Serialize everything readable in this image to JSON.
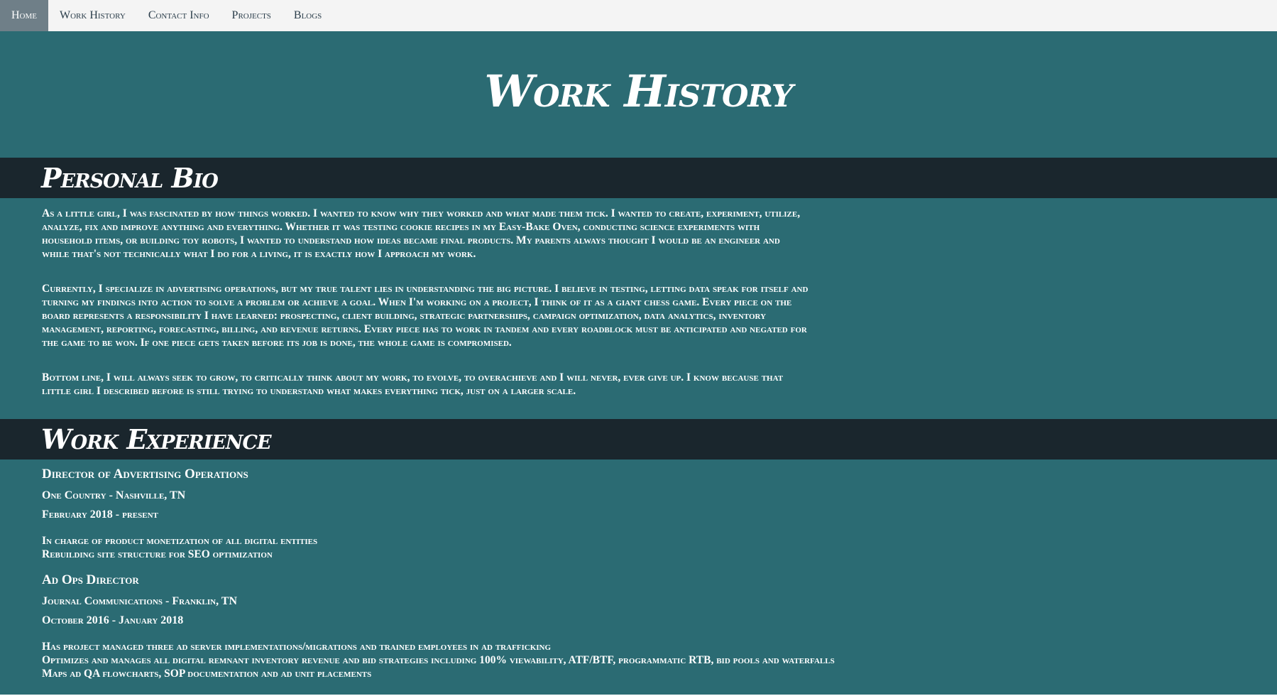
{
  "nav": {
    "items": [
      {
        "label": "Home",
        "active": true
      },
      {
        "label": "Work History",
        "active": false
      },
      {
        "label": "Contact Info",
        "active": false
      },
      {
        "label": "Projects",
        "active": false
      },
      {
        "label": "Blogs",
        "active": false
      }
    ]
  },
  "hero": {
    "title": "Work History"
  },
  "bio": {
    "heading": "Personal Bio",
    "paragraphs": [
      "As a little girl, I was fascinated by how things worked. I wanted to know why they worked and what made them tick. I wanted to create, experiment, utilize, analyze, fix and improve anything and everything. Whether it was testing cookie recipes in my Easy-Bake Oven, conducting science experiments with household items, or building toy robots, I wanted to understand how ideas became final products. My parents always thought I would be an engineer and while that's not technically what I do for a living, it is exactly how I approach my work.",
      "Currently, I specialize in advertising operations, but my true talent lies in understanding the big picture. I believe in testing, letting data speak for itself and turning my findings into action to solve a problem or achieve a goal. When I'm working on a project, I think of it as a giant chess game. Every piece on the board represents a responsibility I have learned: prospecting, client building, strategic partnerships, campaign optimization, data analytics, inventory management, reporting, forecasting, billing, and revenue returns. Every piece has to work in tandem and every roadblock must be anticipated and negated for the game to be won. If one piece gets taken before its job is done, the whole game is compromised.",
      "Bottom line, I will always seek to grow, to critically think about my work, to evolve, to overachieve and I will never, ever give up. I know because that little girl I described before is still trying to understand what makes everything tick, just on a larger scale."
    ]
  },
  "experience": {
    "heading": "Work Experience",
    "jobs": [
      {
        "title": "Director of Advertising Operations",
        "company": "One Country - Nashville, TN",
        "dates": "February 2018 - present",
        "duties": [
          "In charge of product monetization of all digital entities",
          "Rebuilding site structure for SEO optimization"
        ]
      },
      {
        "title": "Ad Ops Director",
        "company": "Journal Communications - Franklin, TN",
        "dates": "October 2016 - January 2018",
        "duties": [
          "Has project managed three ad server implementations/migrations and trained employees in ad trafficking",
          "Optimizes and manages all digital remnant inventory revenue and bid strategies including 100% viewability, ATF/BTF, programmatic RTB, bid pools and waterfalls",
          "Maps ad QA flowcharts, SOP documentation and ad unit placements"
        ]
      }
    ]
  }
}
